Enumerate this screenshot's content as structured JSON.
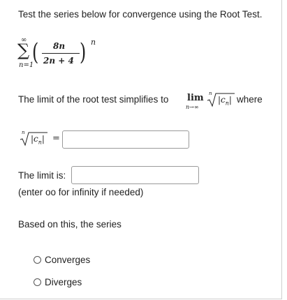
{
  "question": {
    "prompt": "Test the series below for convergence using the Root Test.",
    "series": {
      "sigma": "∑",
      "upper": "∞",
      "lower": "n=1",
      "numerator": "8n",
      "denominator": "2n + 4",
      "exponent": "n",
      "left_paren": "(",
      "right_paren": ")"
    },
    "limit_sentence": {
      "before": "The limit of the root test simplifies to",
      "lim": "lim",
      "lim_sub": "n→∞",
      "root_index": "n",
      "radicand": "|c",
      "radicand_sub": "n",
      "radicand_close": "|",
      "after": "where"
    },
    "root_expr": {
      "root_index": "n",
      "radicand": "|c",
      "radicand_sub": "n",
      "radicand_close": "|",
      "equals": "="
    },
    "root_answer": {
      "value": "",
      "placeholder": ""
    },
    "limit_label": "The limit is:",
    "limit_answer": {
      "value": "",
      "placeholder": ""
    },
    "hint": "(enter oo for infinity if needed)",
    "conclusion": "Based on this, the series",
    "options": [
      {
        "label": "Converges",
        "selected": false
      },
      {
        "label": "Diverges",
        "selected": false
      }
    ]
  }
}
